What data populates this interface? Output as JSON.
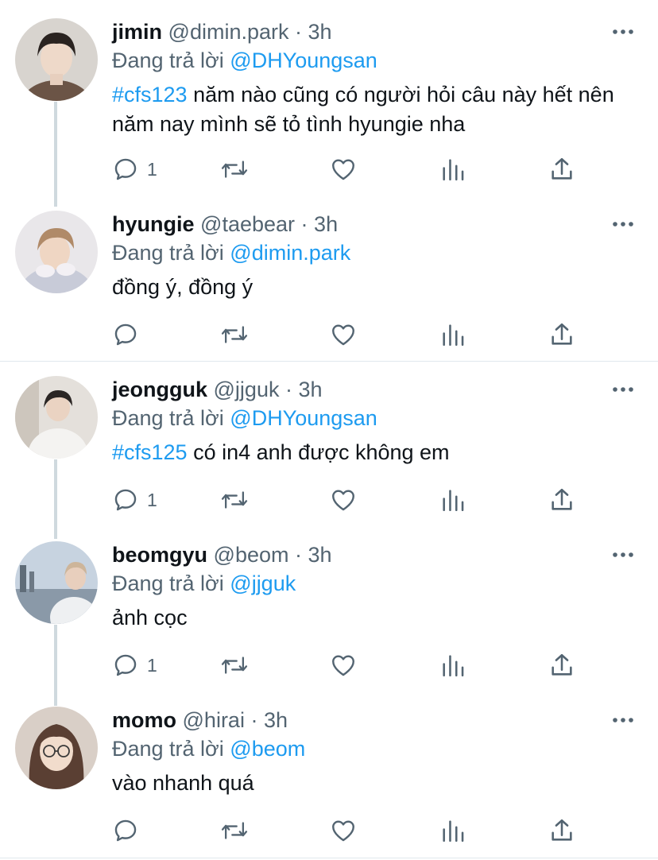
{
  "reply_prefix": "Đang trả lời",
  "tweets": [
    {
      "name": "jimin",
      "handle": "@dimin.park",
      "separator": "·",
      "time": "3h",
      "reply_to": "@DHYoungsan",
      "hashtag": "#cfs123",
      "text": " năm nào cũng có người hỏi câu này hết nên năm nay mình sẽ tỏ tình hyungie nha",
      "reply_count": "1"
    },
    {
      "name": "hyungie",
      "handle": "@taebear",
      "separator": "·",
      "time": "3h",
      "reply_to": "@dimin.park",
      "hashtag": "",
      "text": "đồng ý, đồng ý",
      "reply_count": ""
    },
    {
      "name": "jeongguk",
      "handle": "@jjguk",
      "separator": "·",
      "time": "3h",
      "reply_to": "@DHYoungsan",
      "hashtag": "#cfs125",
      "text": " có in4 anh được không em",
      "reply_count": "1"
    },
    {
      "name": "beomgyu",
      "handle": "@beom",
      "separator": "·",
      "time": "3h",
      "reply_to": "@jjguk",
      "hashtag": "",
      "text": "ảnh cọc",
      "reply_count": "1"
    },
    {
      "name": "momo",
      "handle": "@hirai",
      "separator": "·",
      "time": "3h",
      "reply_to": "@beom",
      "hashtag": "",
      "text": "vào nhanh quá",
      "reply_count": ""
    }
  ],
  "icons": {
    "reply": "reply-icon",
    "retweet": "retweet-icon",
    "like": "like-icon",
    "analytics": "analytics-icon",
    "share": "share-icon",
    "more": "more-icon"
  },
  "colors": {
    "link": "#1d9bf0",
    "secondary_text": "#536471",
    "icon": "#536471",
    "thread_line": "#cfd9de"
  }
}
